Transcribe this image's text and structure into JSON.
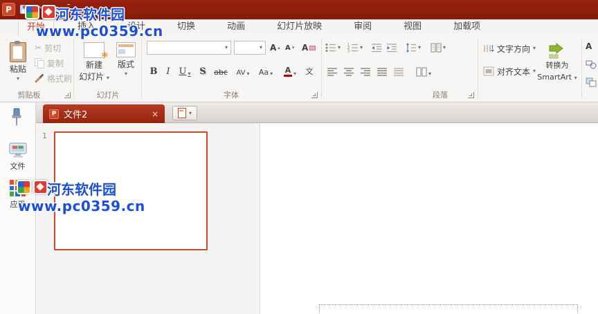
{
  "qat": {
    "logo_letter": "P"
  },
  "glyphs": {
    "dropdown": "▾",
    "close": "×",
    "scissors": "✂",
    "undo": "↶",
    "redo": "↷"
  },
  "tabs": {
    "items": [
      {
        "label": "开始",
        "active": true
      },
      {
        "label": "插入"
      },
      {
        "label": "设计"
      },
      {
        "label": "切换"
      },
      {
        "label": "动画"
      },
      {
        "label": "幻灯片放映"
      },
      {
        "label": "审阅"
      },
      {
        "label": "视图"
      },
      {
        "label": "加载项"
      }
    ]
  },
  "ribbon": {
    "clipboard": {
      "group_label": "剪贴板",
      "paste_label": "粘贴",
      "cut_label": "剪切",
      "copy_label": "复制",
      "format_painter_label": "格式刷"
    },
    "slides": {
      "group_label": "幻灯片",
      "new_slide_line1": "新建",
      "new_slide_line2": "幻灯片",
      "layout_label": "版式"
    },
    "font": {
      "group_label": "字体",
      "font_name_value": "",
      "font_size_value": "",
      "bold": "B",
      "italic": "I",
      "underline": "U",
      "shadow": "S",
      "strikethrough": "abc",
      "char_spacing": "AV",
      "change_case": "Aa",
      "font_color_letter": "A",
      "asian_layout": "文",
      "grow_letter": "A",
      "shrink_letter": "A"
    },
    "paragraph": {
      "group_label": "段落",
      "text_direction_label": "文字方向",
      "align_text_label": "对齐文本",
      "smartart_line1": "转换为",
      "smartart_line2": "SmartArt"
    },
    "drawing_stub": {
      "textbox_letter": "A"
    }
  },
  "doc_tabbar": {
    "active_tab_label": "文件2",
    "active_tab_icon_letter": "P"
  },
  "sidebar": {
    "file_label": "文件",
    "apps_label": "应用"
  },
  "slides_panel": {
    "slide_number": "1"
  },
  "watermark": {
    "site_name": "河东软件园",
    "site_url": "www.pc0359.cn"
  },
  "colors": {
    "titlebar": "#8e1b0c",
    "accent": "#c13b1a",
    "active_tab_red": "#9a2512",
    "selection_border": "#cf4a2a",
    "watermark_blue": "#1b4fd8"
  }
}
